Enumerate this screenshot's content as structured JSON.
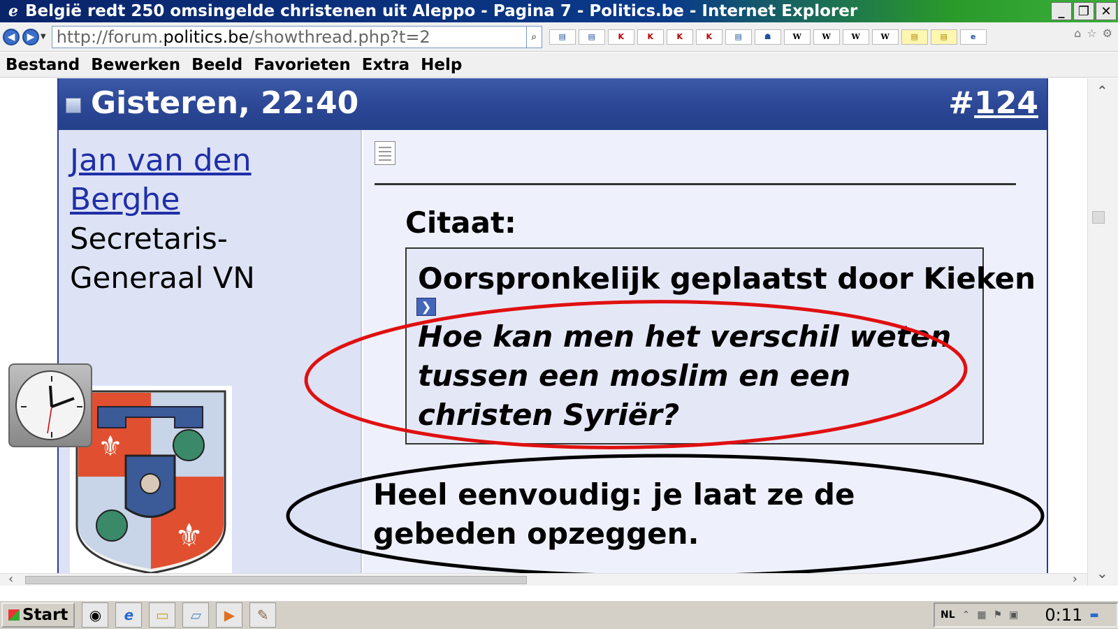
{
  "window": {
    "title": "België redt 250 omsingelde christenen uit Aleppo - Pagina 7 - Politics.be - Internet Explorer",
    "buttons": {
      "minimize": "_",
      "restore": "❐",
      "close": "✕"
    }
  },
  "address": {
    "url_prefix": "http://forum.",
    "url_domain": "politics.be",
    "url_suffix": "/showthread.php?t=2"
  },
  "favorites": [
    "K",
    "K",
    "K",
    "K",
    "W",
    "W",
    "W",
    "W"
  ],
  "menu": [
    "Bestand",
    "Bewerken",
    "Beeld",
    "Favorieten",
    "Extra",
    "Help"
  ],
  "post": {
    "date": "Gisteren, 22:40",
    "number_hash": "#",
    "number": "124",
    "username": "Jan van den Berghe",
    "user_title": "Secretaris-Generaal VN",
    "quote_label": "Citaat:",
    "quote_prefix": "Oorspronkelijk geplaatst door ",
    "quote_author": "Kieken",
    "quote_text": "Hoe kan men het verschil weten tussen een moslim en een christen Syriër?",
    "reply_text": "Heel eenvoudig: je laat ze de gebeden opzeggen."
  },
  "taskbar": {
    "start": "Start",
    "language": "NL",
    "time": "0:11"
  },
  "colors": {
    "header_blue": "#2c4896",
    "annotation_red": "#e01010",
    "annotation_black": "#000000"
  }
}
